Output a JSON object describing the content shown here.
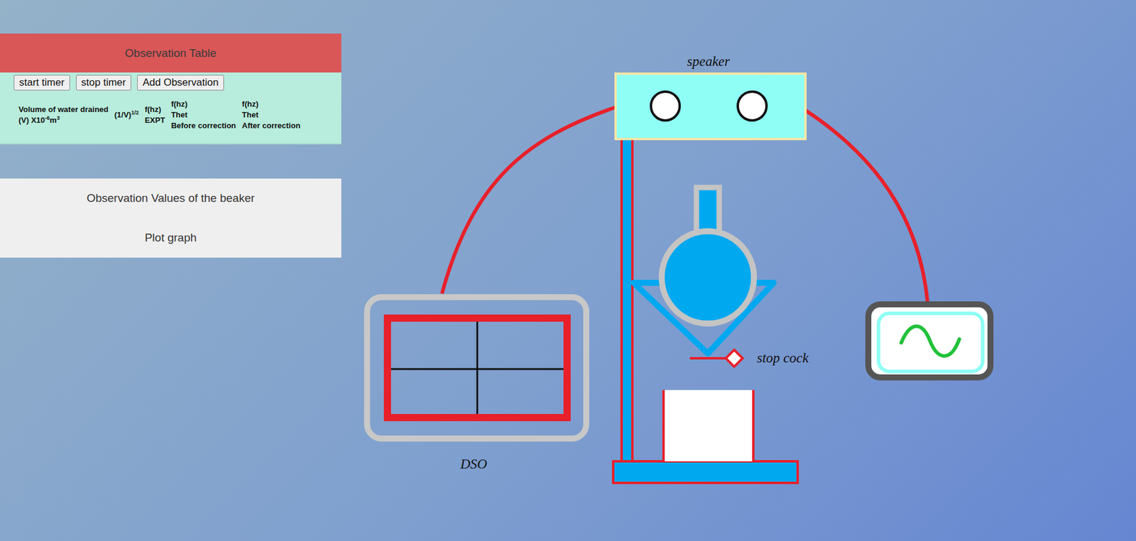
{
  "observationTable": {
    "title": "Observation Table",
    "buttons": [
      "start timer",
      "stop timer",
      "Add Observation"
    ],
    "columns": [
      {
        "lines": [
          [
            {
              "text": "Volume of water drained",
              "sup": false
            }
          ],
          [
            {
              "text": "(V) X10",
              "sup": false
            },
            {
              "text": "-6",
              "sup": true
            },
            {
              "text": "m",
              "sup": false
            },
            {
              "text": "3",
              "sup": true
            }
          ]
        ]
      },
      {
        "lines": [
          [
            {
              "text": "(1/V)",
              "sup": false
            },
            {
              "text": "1/2",
              "sup": true
            }
          ]
        ]
      },
      {
        "lines": [
          [
            {
              "text": "f(hz)",
              "sup": false
            }
          ],
          [
            {
              "text": "EXPT",
              "sup": false
            }
          ]
        ]
      },
      {
        "lines": [
          [
            {
              "text": "f(hz)",
              "sup": false
            }
          ],
          [
            {
              "text": "Thet",
              "sup": false
            }
          ],
          [
            {
              "text": "Before correction",
              "sup": false
            }
          ]
        ]
      },
      {
        "lines": [
          [
            {
              "text": "f(hz)",
              "sup": false
            }
          ],
          [
            {
              "text": "Thet",
              "sup": false
            }
          ],
          [
            {
              "text": "After correction",
              "sup": false
            }
          ]
        ]
      }
    ],
    "rows": []
  },
  "beakerPanel": {
    "items": [
      "Observation Values of the beaker",
      "Plot graph"
    ]
  },
  "diagram": {
    "labels": {
      "speaker": "speaker",
      "dso": "DSO",
      "stopCock": "stop cock"
    }
  }
}
